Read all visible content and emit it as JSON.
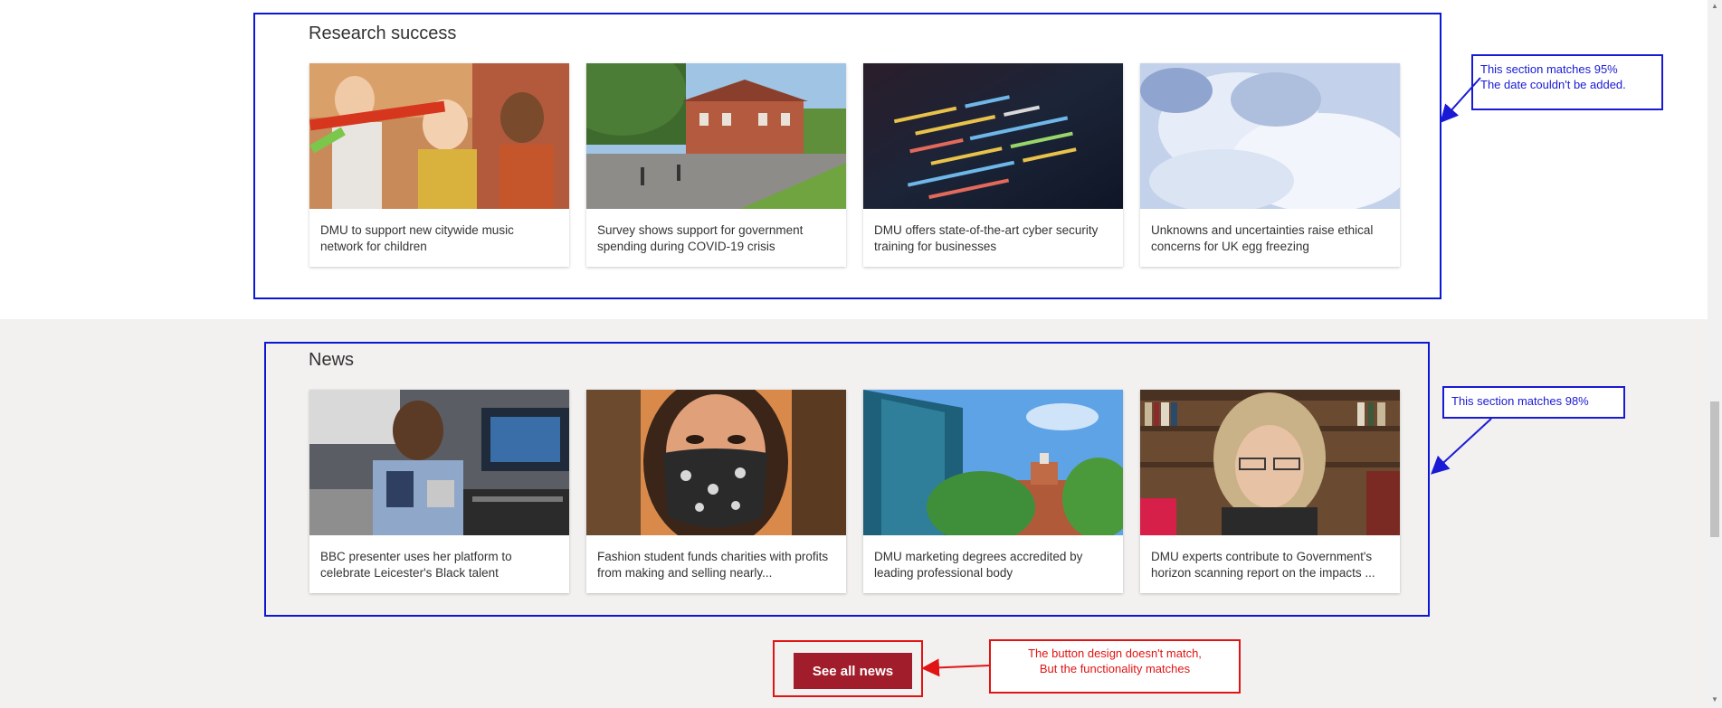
{
  "research": {
    "title": "Research success",
    "cards": [
      {
        "text": "DMU to support new citywide music network for children",
        "image": "children-music-photo"
      },
      {
        "text": "Survey shows support for government spending during COVID-19 crisis",
        "image": "campus-building-photo"
      },
      {
        "text": "DMU offers state-of-the-art cyber security training for businesses",
        "image": "code-screen-photo"
      },
      {
        "text": "Unknowns and uncertainties raise ethical concerns for UK egg freezing",
        "image": "cryo-vapour-photo"
      }
    ]
  },
  "news": {
    "title": "News",
    "cards": [
      {
        "text": "BBC presenter uses her platform to celebrate Leicester's Black talent",
        "image": "radio-presenter-photo"
      },
      {
        "text": "Fashion student funds charities with profits from making and selling nearly...",
        "image": "face-mask-photo"
      },
      {
        "text": "DMU marketing degrees accredited by leading professional body",
        "image": "university-buildings-photo"
      },
      {
        "text": "DMU experts contribute to Government's horizon scanning report on the impacts ...",
        "image": "expert-bookshelf-photo"
      }
    ],
    "button_label": "See all news"
  },
  "annotations": {
    "research_note": [
      "This section matches 95%",
      "The date couldn't be added."
    ],
    "news_note": [
      "This section matches 98%"
    ],
    "button_note": [
      "The button design doesn't match,",
      "But the functionality matches"
    ]
  },
  "colors": {
    "button": "#a11d2b",
    "annotation_blue": "#0b16d6",
    "annotation_red": "#e01414",
    "grey_band": "#f2f1f0"
  }
}
